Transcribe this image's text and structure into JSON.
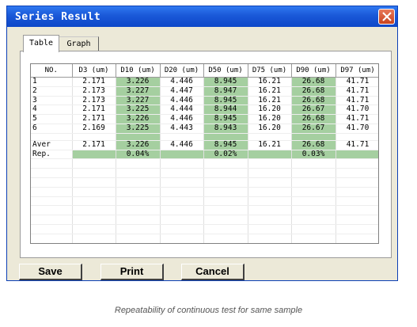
{
  "window": {
    "title": "Series Result"
  },
  "tabs": [
    {
      "label": "Table"
    },
    {
      "label": "Graph"
    }
  ],
  "table": {
    "headers": [
      "NO.",
      "D3 (um)",
      "D10 (um)",
      "D20 (um)",
      "D50 (um)",
      "D75 (um)",
      "D90 (um)",
      "D97 (um)"
    ],
    "rows": [
      [
        "1",
        "2.171",
        "3.226",
        "4.446",
        "8.945",
        "16.21",
        "26.68",
        "41.71"
      ],
      [
        "2",
        "2.173",
        "3.227",
        "4.447",
        "8.947",
        "16.21",
        "26.68",
        "41.71"
      ],
      [
        "3",
        "2.173",
        "3.227",
        "4.446",
        "8.945",
        "16.21",
        "26.68",
        "41.71"
      ],
      [
        "4",
        "2.171",
        "3.225",
        "4.444",
        "8.944",
        "16.20",
        "26.67",
        "41.70"
      ],
      [
        "5",
        "2.171",
        "3.226",
        "4.446",
        "8.945",
        "16.20",
        "26.68",
        "41.71"
      ],
      [
        "6",
        "2.169",
        "3.225",
        "4.443",
        "8.943",
        "16.20",
        "26.67",
        "41.70"
      ]
    ],
    "aver": [
      "Aver",
      "2.171",
      "3.226",
      "4.446",
      "8.945",
      "16.21",
      "26.68",
      "41.71"
    ],
    "rep": [
      "Rep.",
      "",
      "0.04%",
      "",
      "0.02%",
      "",
      "0.03%",
      ""
    ]
  },
  "buttons": {
    "save": "Save",
    "print": "Print",
    "cancel": "Cancel"
  },
  "caption": "Repeatability of continuous test for same sample",
  "colors": {
    "highlight": "#a5cfa0",
    "titlebar": "#1a58d8",
    "window_bg": "#ece9d8"
  }
}
